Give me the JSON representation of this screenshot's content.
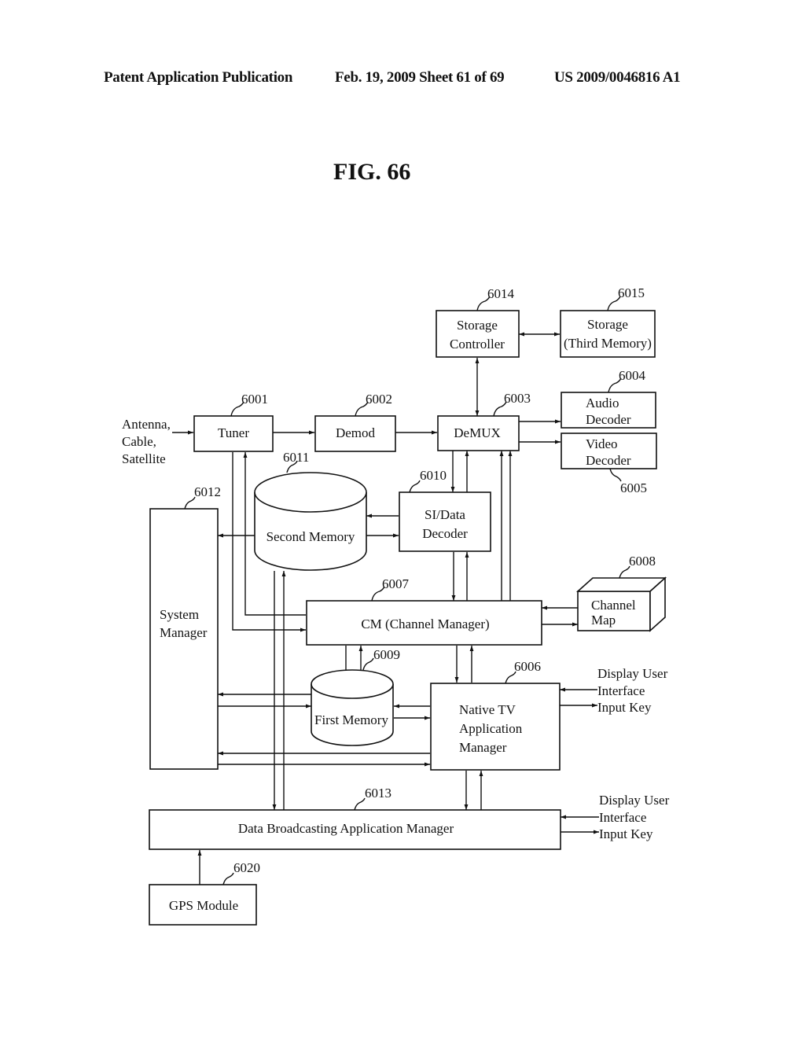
{
  "header": {
    "publication": "Patent Application Publication",
    "date_sheet": "Feb. 19, 2009  Sheet 61 of 69",
    "patent_number": "US 2009/0046816 A1"
  },
  "figure": {
    "title": "FIG. 66",
    "inputs": {
      "antenna": [
        "Antenna,",
        "Cable,",
        "Satellite"
      ],
      "user_input_1": [
        "Display User",
        "Interface",
        "Input Key"
      ],
      "user_input_2": [
        "Display User",
        "Interface",
        "Input Key"
      ]
    },
    "blocks": {
      "tuner": {
        "ref": "6001",
        "label": [
          "Tuner"
        ]
      },
      "demod": {
        "ref": "6002",
        "label": [
          "Demod"
        ]
      },
      "demux": {
        "ref": "6003",
        "label": [
          "DeMUX"
        ]
      },
      "audio_decoder": {
        "ref": "6004",
        "label": [
          "Audio",
          "Decoder"
        ]
      },
      "video_decoder": {
        "ref": "6005",
        "label": [
          "Video",
          "Decoder"
        ]
      },
      "native_tv_app_manager": {
        "ref": "6006",
        "label": [
          "Native TV",
          "Application",
          "Manager"
        ]
      },
      "channel_manager": {
        "ref": "6007",
        "label": [
          "CM (Channel Manager)"
        ]
      },
      "channel_map": {
        "ref": "6008",
        "label": [
          "Channel",
          "Map"
        ]
      },
      "first_memory": {
        "ref": "6009",
        "label": [
          "First Memory"
        ]
      },
      "si_data_decoder": {
        "ref": "6010",
        "label": [
          "SI/Data",
          "Decoder"
        ]
      },
      "second_memory": {
        "ref": "6011",
        "label": [
          "Second Memory"
        ]
      },
      "system_manager": {
        "ref": "6012",
        "label": [
          "System",
          "Manager"
        ]
      },
      "data_broadcasting_app_manager": {
        "ref": "6013",
        "label": [
          "Data Broadcasting Application Manager"
        ]
      },
      "storage_controller": {
        "ref": "6014",
        "label": [
          "Storage",
          "Controller"
        ]
      },
      "storage_third_memory": {
        "ref": "6015",
        "label": [
          "Storage",
          "(Third Memory)"
        ]
      },
      "gps_module": {
        "ref": "6020",
        "label": [
          "GPS Module"
        ]
      }
    }
  }
}
